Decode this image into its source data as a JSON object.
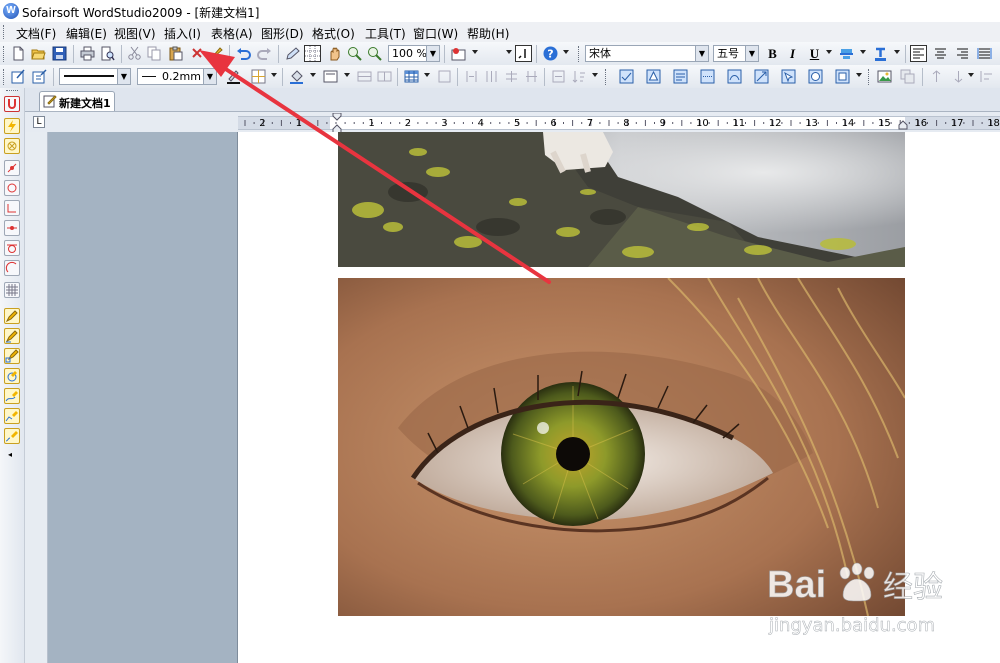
{
  "window": {
    "title": "Sofairsoft WordStudio2009 - [新建文档1]",
    "app_icon_letter": "W"
  },
  "menu": {
    "items": [
      {
        "label": "文档(F)"
      },
      {
        "label": "编辑(E)"
      },
      {
        "label": "视图(V)"
      },
      {
        "label": "插入(I)"
      },
      {
        "label": "表格(A)"
      },
      {
        "label": "图形(D)"
      },
      {
        "label": "格式(O)"
      },
      {
        "label": "工具(T)"
      },
      {
        "label": "窗口(W)"
      },
      {
        "label": "帮助(H)"
      }
    ]
  },
  "toolbar_standard": {
    "zoom_value": "100 %",
    "font_name": "宋体",
    "font_size": "五号",
    "bold_label": "B",
    "italic_label": "I",
    "underline_label": "U"
  },
  "toolbar_drawing": {
    "line_style_value": "",
    "line_width_value": "0.2mm"
  },
  "tabs": [
    {
      "label": "新建文档1",
      "active": true
    }
  ],
  "ruler": {
    "tab_selector_glyph": "L",
    "labels": [
      "2",
      "1",
      "1",
      "2",
      "3",
      "4",
      "5",
      "6",
      "7",
      "8",
      "9",
      "10",
      "11",
      "12",
      "13",
      "14",
      "15",
      "16",
      "17",
      "18"
    ]
  },
  "watermark": {
    "brand_text": "Bai",
    "brand_suffix": "经验",
    "url_text": "jingyan.baidu.com"
  },
  "colors": {
    "annotation_arrow": "#e8343f",
    "nav_pane": "#a4b3c2",
    "accent_blue": "#2a6fd6"
  }
}
